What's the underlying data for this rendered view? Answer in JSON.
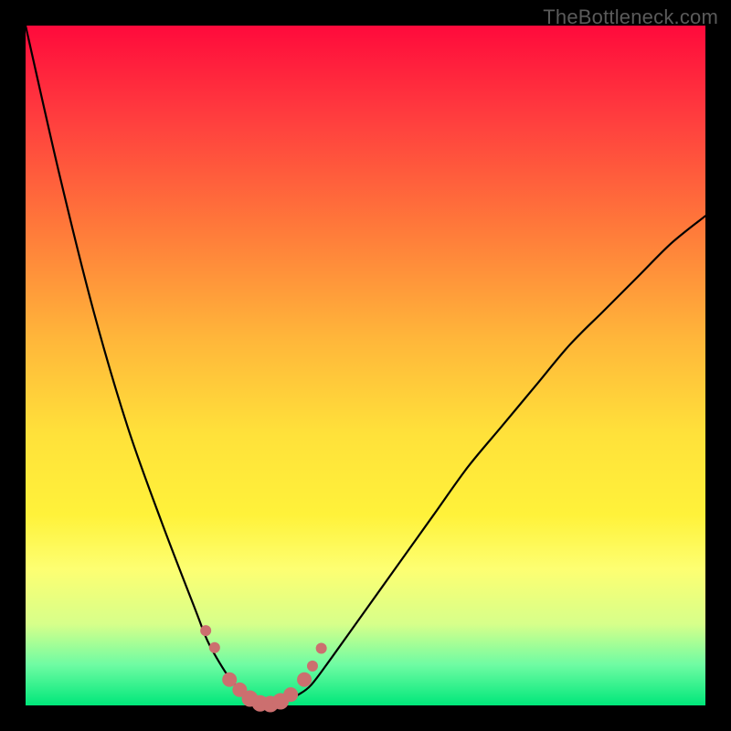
{
  "watermark": "TheBottleneck.com",
  "chart_data": {
    "type": "line",
    "title": "",
    "xlabel": "",
    "ylabel": "",
    "xlim": [
      0,
      100
    ],
    "ylim": [
      0,
      100
    ],
    "series": [
      {
        "name": "bottleneck-curve",
        "x": [
          0,
          5,
          10,
          15,
          20,
          25,
          27,
          30,
          32,
          34,
          36,
          38,
          40,
          42,
          45,
          50,
          55,
          60,
          65,
          70,
          75,
          80,
          85,
          90,
          95,
          100
        ],
        "values": [
          100,
          78,
          58,
          41,
          27,
          14,
          9,
          4,
          2,
          0.6,
          0,
          0.4,
          1.5,
          3,
          7,
          14,
          21,
          28,
          35,
          41,
          47,
          53,
          58,
          63,
          68,
          72
        ]
      }
    ],
    "markers": {
      "name": "near-minimum-dots",
      "x": [
        26.5,
        27.8,
        30,
        31.5,
        33,
        34.5,
        36,
        37.5,
        39,
        41,
        42.2,
        43.5
      ],
      "values": [
        11,
        8.5,
        3.8,
        2.3,
        1,
        0.3,
        0.2,
        0.6,
        1.6,
        3.8,
        5.8,
        8.4
      ],
      "radius": [
        6,
        6,
        8,
        8,
        9,
        9,
        9,
        9,
        8,
        8,
        6,
        6
      ],
      "color": "#cc6f6f"
    },
    "gradient_stops": [
      {
        "pos": 0.0,
        "color": "#ff0a3c"
      },
      {
        "pos": 0.14,
        "color": "#ff3f3e"
      },
      {
        "pos": 0.3,
        "color": "#ff7a3a"
      },
      {
        "pos": 0.46,
        "color": "#ffb63a"
      },
      {
        "pos": 0.6,
        "color": "#ffe13a"
      },
      {
        "pos": 0.72,
        "color": "#fff23a"
      },
      {
        "pos": 0.8,
        "color": "#fdff72"
      },
      {
        "pos": 0.88,
        "color": "#d7ff8a"
      },
      {
        "pos": 0.94,
        "color": "#6ffca3"
      },
      {
        "pos": 1.0,
        "color": "#00e77a"
      }
    ]
  }
}
